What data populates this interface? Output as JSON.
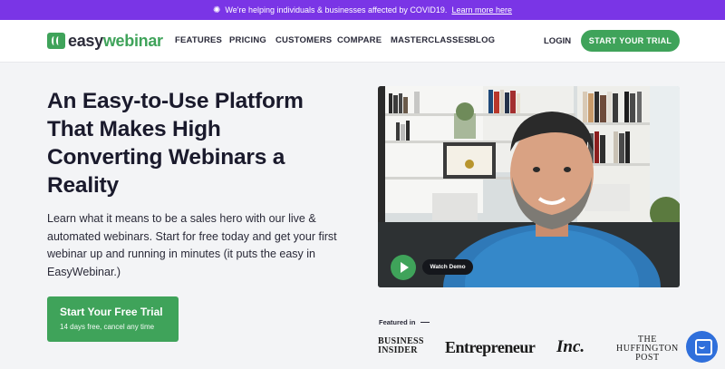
{
  "banner": {
    "text": "We're helping individuals & businesses affected by COVID19.",
    "link": "Learn more here"
  },
  "nav": {
    "logo_prefix": "easy",
    "logo_suffix": "webinar",
    "items": [
      "FEATURES",
      "PRICING",
      "CUSTOMERS",
      "COMPARE",
      "MASTERCLASSES",
      "BLOG"
    ],
    "login": "LOGIN",
    "cta": "START YOUR TRIAL"
  },
  "hero": {
    "headline_lines": [
      "An Easy-to-Use Platform",
      "That Makes High",
      "Converting Webinars a",
      "Reality"
    ],
    "subtext_lines": [
      "Learn what it means to be a sales hero with our live &",
      "automated webinars. Start for free today and get your first",
      "webinar up and running in minutes (it puts the easy in",
      "EasyWebinar.)"
    ],
    "cta_title": "Start Your Free Trial",
    "cta_subtitle": "14 days free, cancel any time"
  },
  "video": {
    "watch_label": "Watch Demo"
  },
  "featured": {
    "label": "Featured in",
    "logos": {
      "business_insider": [
        "BUSINESS",
        "INSIDER"
      ],
      "entrepreneur": "Entrepreneur",
      "inc": "Inc.",
      "huffington": [
        "THE",
        "HUFFINGTON",
        "POST"
      ]
    }
  },
  "colors": {
    "brand_green": "#3fa35a",
    "banner_purple": "#7a35e6",
    "chat_blue": "#2f6fdb"
  },
  "icons": {
    "banner": "virus-icon",
    "play": "play-icon",
    "chat": "chat-icon"
  }
}
